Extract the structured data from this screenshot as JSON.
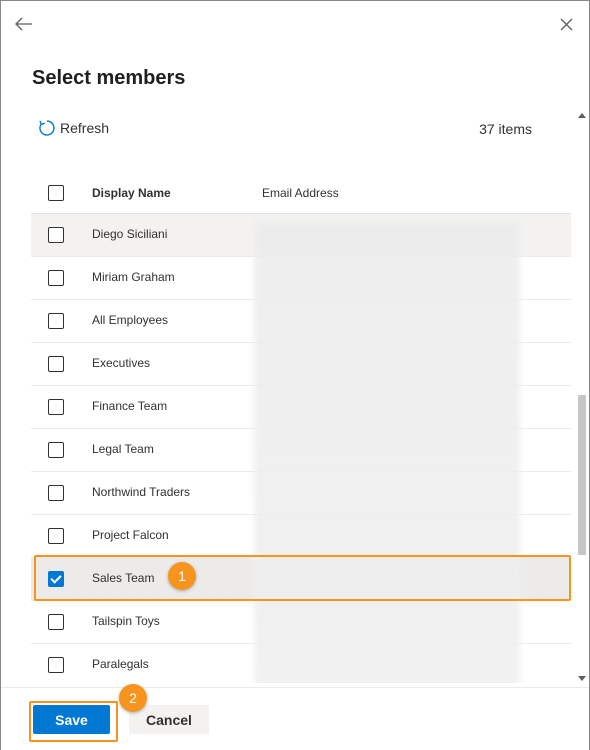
{
  "dialog": {
    "title": "Select members",
    "refresh_label": "Refresh",
    "item_count": "37 items"
  },
  "columns": {
    "display_name": "Display Name",
    "email_address": "Email Address"
  },
  "rows": [
    {
      "name": "Diego Siciliani",
      "checked": false
    },
    {
      "name": "Miriam Graham",
      "checked": false
    },
    {
      "name": "All Employees",
      "checked": false
    },
    {
      "name": "Executives",
      "checked": false
    },
    {
      "name": "Finance Team",
      "checked": false
    },
    {
      "name": "Legal Team",
      "checked": false
    },
    {
      "name": "Northwind Traders",
      "checked": false
    },
    {
      "name": "Project Falcon",
      "checked": false
    },
    {
      "name": "Sales Team",
      "checked": true
    },
    {
      "name": "Tailspin Toys",
      "checked": false
    },
    {
      "name": "Paralegals",
      "checked": false
    }
  ],
  "footer": {
    "save_label": "Save",
    "cancel_label": "Cancel"
  },
  "callouts": {
    "step1": "1",
    "step2": "2"
  },
  "colors": {
    "accent": "#0078d4",
    "callout": "#f7941d"
  },
  "icons": {
    "back": "arrow-left-icon",
    "close": "close-icon",
    "refresh": "refresh-icon"
  }
}
